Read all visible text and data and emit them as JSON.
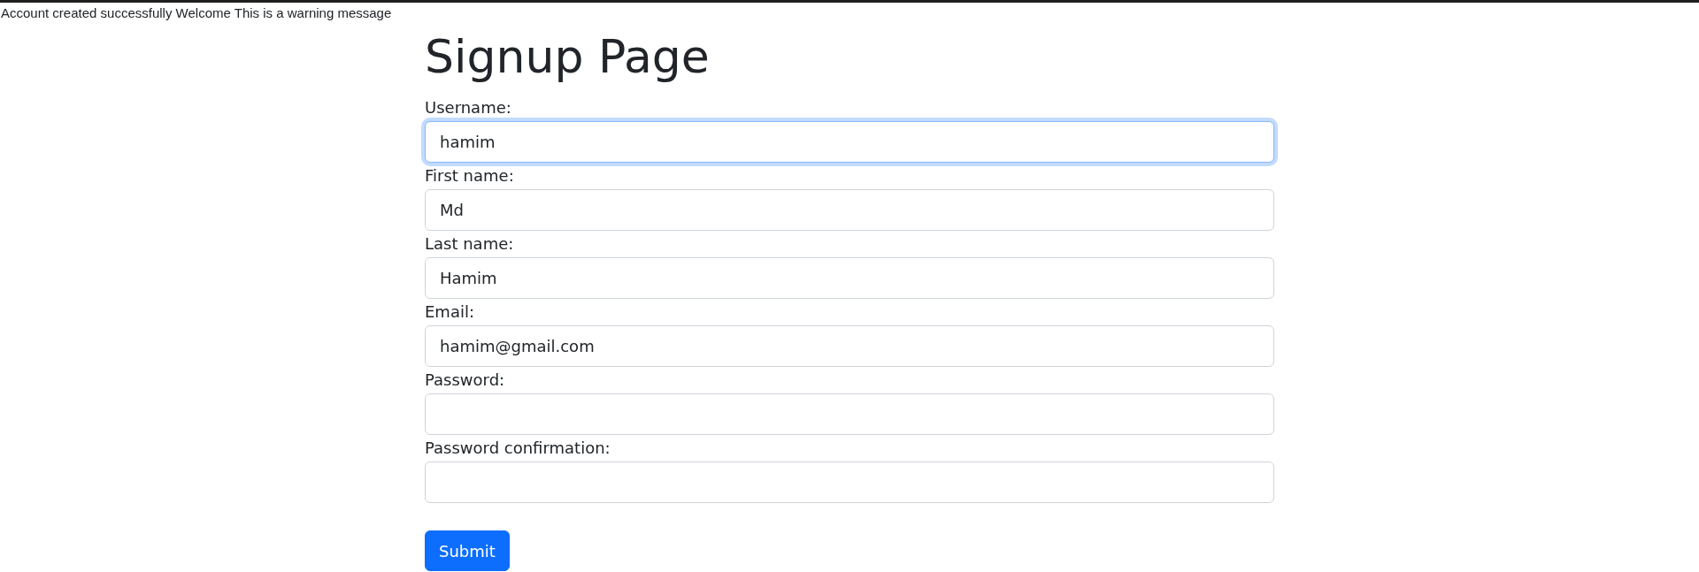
{
  "message": "Account created successfully Welcome This is a warning message",
  "title": "Signup Page",
  "fields": [
    {
      "label": "Username:",
      "value": "hamim",
      "focused": true
    },
    {
      "label": "First name:",
      "value": "Md",
      "focused": false
    },
    {
      "label": "Last name:",
      "value": "Hamim",
      "focused": false
    },
    {
      "label": "Email:",
      "value": "hamim@gmail.com",
      "focused": false
    },
    {
      "label": "Password:",
      "focused": false
    },
    {
      "label": "Password confirmation:",
      "focused": false
    }
  ],
  "submit": "Submit"
}
